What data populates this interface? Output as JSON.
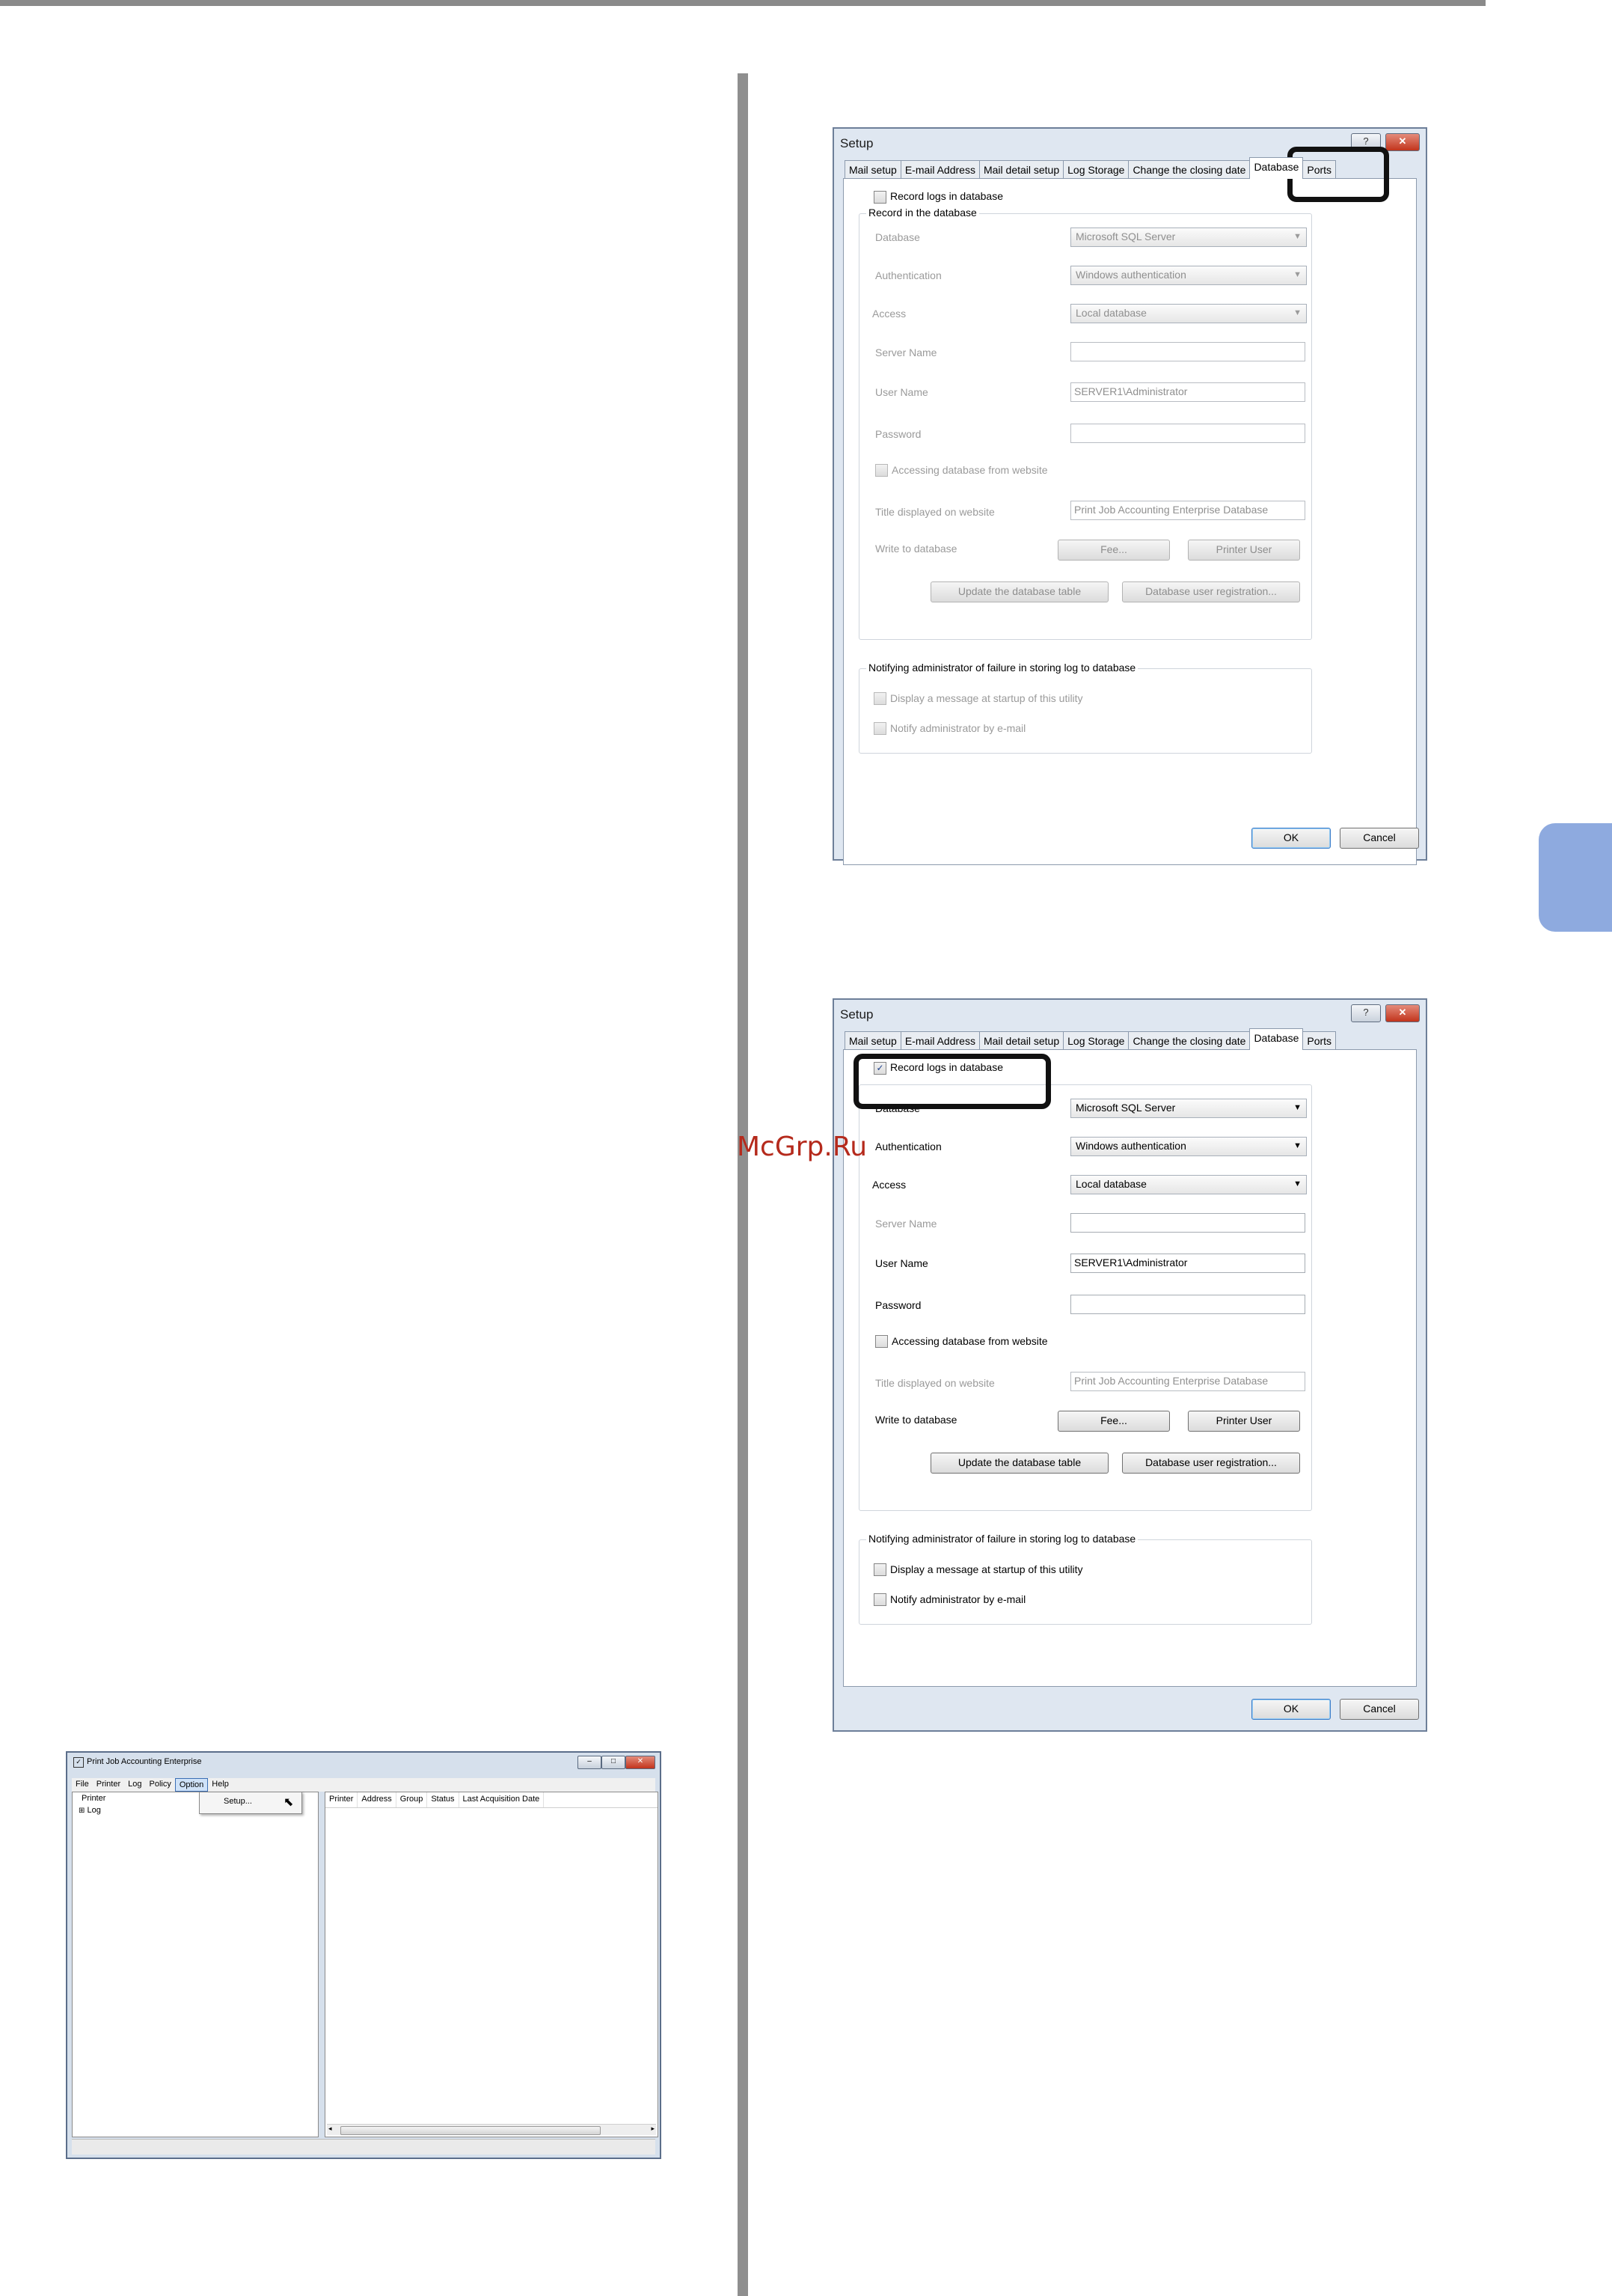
{
  "watermark": "McGrp.Ru",
  "dialog1": {
    "title": "Setup",
    "help_btn": "?",
    "close_btn": "✕",
    "tabs": [
      "Mail setup",
      "E-mail Address",
      "Mail detail setup",
      "Log Storage",
      "Change the closing date",
      "Database",
      "Ports"
    ],
    "record_logs": "Record logs in database",
    "group_record": "Record in the database",
    "database_label": "Database",
    "database_value": "Microsoft SQL Server",
    "auth_label": "Authentication",
    "auth_value": "Windows authentication",
    "access_label": "Access",
    "access_value": "Local database",
    "server_label": "Server Name",
    "server_value": "",
    "user_label": "User Name",
    "user_value": "SERVER1\\Administrator",
    "password_label": "Password",
    "password_value": "",
    "website_access": "Accessing database from website",
    "title_label": "Title displayed on website",
    "title_value": "Print Job Accounting Enterprise Database",
    "write_label": "Write to database",
    "fee_btn": "Fee...",
    "printer_user_btn": "Printer User",
    "update_btn": "Update the database table",
    "registration_btn": "Database user registration...",
    "group_notify": "Notifying administrator of failure in storing log to database",
    "display_msg": "Display a message at startup of this utility",
    "notify_email": "Notify administrator by e-mail",
    "ok": "OK",
    "cancel": "Cancel",
    "record_checked": false
  },
  "dialog2": {
    "title": "Setup",
    "help_btn": "?",
    "close_btn": "✕",
    "tabs": [
      "Mail setup",
      "E-mail Address",
      "Mail detail setup",
      "Log Storage",
      "Change the closing date",
      "Database",
      "Ports"
    ],
    "record_logs": "Record logs in database",
    "record_check": "✓",
    "database_label": "Database",
    "database_value": "Microsoft SQL Server",
    "auth_label": "Authentication",
    "auth_value": "Windows authentication",
    "access_label": "Access",
    "access_value": "Local database",
    "server_label": "Server Name",
    "server_value": "",
    "user_label": "User Name",
    "user_value": "SERVER1\\Administrator",
    "password_label": "Password",
    "password_value": "",
    "website_access": "Accessing database from website",
    "title_label": "Title displayed on website",
    "title_value": "Print Job Accounting Enterprise Database",
    "write_label": "Write to database",
    "fee_btn": "Fee...",
    "printer_user_btn": "Printer User",
    "update_btn": "Update the database table",
    "registration_btn": "Database user registration...",
    "group_notify": "Notifying administrator of failure in storing log to database",
    "display_msg": "Display a message at startup of this utility",
    "notify_email": "Notify administrator by e-mail",
    "ok": "OK",
    "cancel": "Cancel",
    "record_checked": true
  },
  "app": {
    "title": "Print Job Accounting Enterprise",
    "menu": [
      "File",
      "Printer",
      "Log",
      "Policy",
      "Option",
      "Help"
    ],
    "dropdown_item": "Setup...",
    "tree": [
      "Printer",
      "Log"
    ],
    "tree_expander": "⊞",
    "columns": [
      "Printer",
      "Address",
      "Group",
      "Status",
      "Last Acquisition Date"
    ],
    "min_btn": "–",
    "max_btn": "□",
    "close_btn": "✕"
  },
  "colors": {
    "side_tab": "#8eaadf",
    "highlight_box": "#111111",
    "watermark": "#b52a1c"
  }
}
